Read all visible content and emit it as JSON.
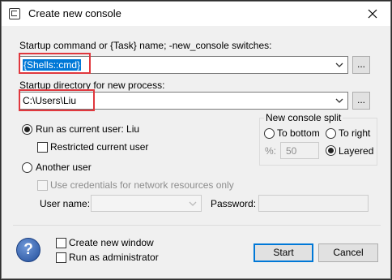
{
  "window": {
    "title": "Create new console",
    "close_glyph": "✕"
  },
  "startup": {
    "command_label": "Startup command or {Task} name; -new_console switches:",
    "command_value": "{Shells::cmd}",
    "command_browse": "...",
    "directory_label": "Startup directory for new process:",
    "directory_value": "C:\\Users\\Liu",
    "directory_browse": "..."
  },
  "run_as": {
    "current_user_label": "Run as current user: Liu",
    "restricted_label": "Restricted current user",
    "another_user_label": "Another user",
    "use_credentials_label": "Use credentials for network resources only",
    "user_name_label": "User name:",
    "user_name_value": "",
    "password_label": "Password:",
    "password_value": ""
  },
  "split": {
    "title": "New console split",
    "to_bottom": "To bottom",
    "to_right": "To right",
    "percent_label": "%:",
    "percent_value": "50",
    "layered": "Layered"
  },
  "footer": {
    "create_new_window": "Create new window",
    "run_as_admin": "Run as administrator",
    "start": "Start",
    "cancel": "Cancel"
  },
  "colors": {
    "highlight_box": "#e0383e",
    "selection": "#0078d7"
  }
}
